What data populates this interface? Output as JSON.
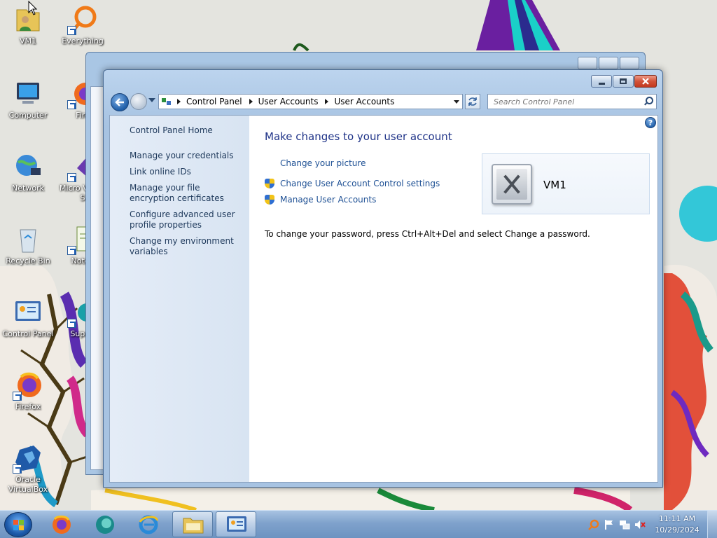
{
  "desktop": {
    "icons": [
      {
        "label": "VM1",
        "icon": "user-folder-icon"
      },
      {
        "label": "Everything",
        "icon": "everything-search-icon"
      },
      {
        "label": "Computer",
        "icon": "computer-icon"
      },
      {
        "label": "Fire",
        "icon": "firefox-icon"
      },
      {
        "label": "Network",
        "icon": "network-icon"
      },
      {
        "label": "Micro Visual S",
        "icon": "visual-studio-icon"
      },
      {
        "label": "Recycle Bin",
        "icon": "recycle-bin-icon"
      },
      {
        "label": "Notep",
        "icon": "notepad-icon"
      },
      {
        "label": "Control Panel",
        "icon": "control-panel-icon"
      },
      {
        "label": "Superi",
        "icon": "app-shortcut-icon"
      },
      {
        "label": "Firefox",
        "icon": "firefox-icon"
      },
      {
        "label": "Oracle VirtualBox",
        "icon": "virtualbox-icon"
      }
    ]
  },
  "window": {
    "address": {
      "crumbs": [
        "Control Panel",
        "User Accounts",
        "User Accounts"
      ]
    },
    "search": {
      "placeholder": "Search Control Panel"
    },
    "left_pane": {
      "home": "Control Panel Home",
      "tasks": [
        "Manage your credentials",
        "Link online IDs",
        "Manage your file encryption certificates",
        "Configure advanced user profile properties",
        "Change my environment variables"
      ]
    },
    "main": {
      "heading": "Make changes to your user account",
      "links": {
        "change_picture": "Change your picture",
        "uac_settings": "Change User Account Control settings",
        "manage_accounts": "Manage User Accounts"
      },
      "password_note": "To change your password, press Ctrl+Alt+Del and select Change a password.",
      "user_name": "VM1"
    },
    "help_glyph": "?"
  },
  "taskbar": {
    "time": "11:11 AM",
    "date": "10/29/2024"
  }
}
